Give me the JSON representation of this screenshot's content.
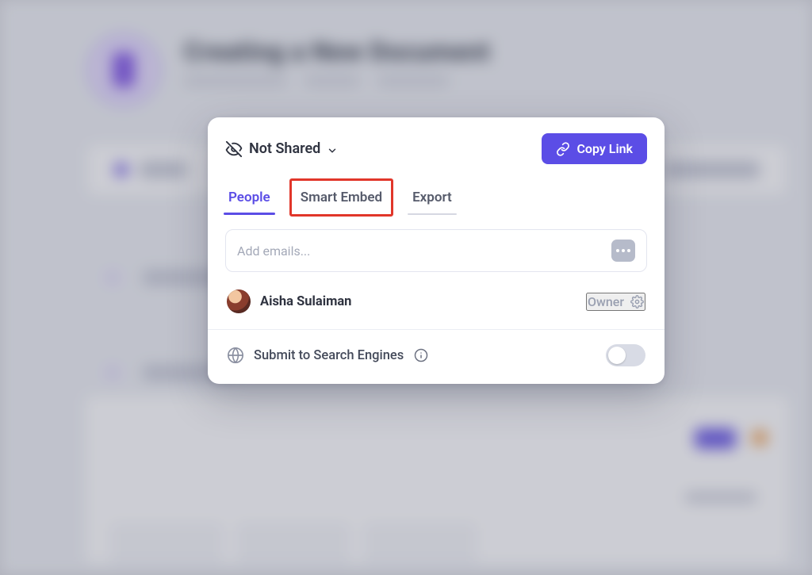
{
  "background": {
    "title": "Creating a New Document",
    "author": "Aisha Sulaiman",
    "meta_steps": "6 steps",
    "meta_time": "32 seconds"
  },
  "modal": {
    "share_status_label": "Not Shared",
    "copy_link_label": "Copy Link",
    "tabs": {
      "people": "People",
      "smart_embed": "Smart Embed",
      "export": "Export",
      "active": "people",
      "highlighted": "smart_embed"
    },
    "email_placeholder": "Add emails...",
    "person": {
      "name": "Aisha Sulaiman",
      "role": "Owner"
    },
    "submit_search": {
      "label": "Submit to Search Engines",
      "enabled": false
    }
  },
  "colors": {
    "accent": "#5b4de6",
    "highlight_box": "#e1362a"
  }
}
